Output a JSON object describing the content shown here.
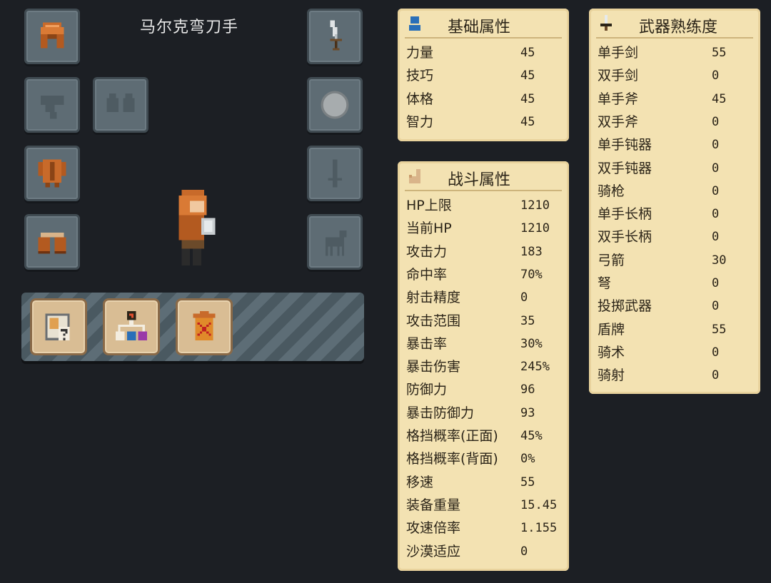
{
  "character": {
    "name": "马尔克弯刀手"
  },
  "basic_attributes": {
    "title": "基础属性",
    "icon": "person-icon",
    "rows": [
      {
        "label": "力量",
        "value": "45"
      },
      {
        "label": "技巧",
        "value": "45"
      },
      {
        "label": "体格",
        "value": "45"
      },
      {
        "label": "智力",
        "value": "45"
      }
    ]
  },
  "combat_attributes": {
    "title": "战斗属性",
    "icon": "arm-icon",
    "rows": [
      {
        "label": "HP上限",
        "value": "1210"
      },
      {
        "label": "当前HP",
        "value": "1210"
      },
      {
        "label": "攻击力",
        "value": "183"
      },
      {
        "label": "命中率",
        "value": "70%"
      },
      {
        "label": "射击精度",
        "value": "0"
      },
      {
        "label": "攻击范围",
        "value": "35"
      },
      {
        "label": "暴击率",
        "value": "30%"
      },
      {
        "label": "暴击伤害",
        "value": "245%"
      },
      {
        "label": "防御力",
        "value": "96"
      },
      {
        "label": "暴击防御力",
        "value": "93"
      },
      {
        "label": "格挡概率(正面)",
        "value": "45%"
      },
      {
        "label": "格挡概率(背面)",
        "value": "0%"
      },
      {
        "label": "移速",
        "value": "55"
      },
      {
        "label": "装备重量",
        "value": "15.45"
      },
      {
        "label": "攻速倍率",
        "value": "1.155"
      },
      {
        "label": "沙漠适应",
        "value": "0"
      }
    ]
  },
  "weapon_proficiency": {
    "title": "武器熟练度",
    "icon": "sword-icon",
    "rows": [
      {
        "label": "单手剑",
        "value": "55"
      },
      {
        "label": "双手剑",
        "value": "0"
      },
      {
        "label": "单手斧",
        "value": "45"
      },
      {
        "label": "双手斧",
        "value": "0"
      },
      {
        "label": "单手钝器",
        "value": "0"
      },
      {
        "label": "双手钝器",
        "value": "0"
      },
      {
        "label": "骑枪",
        "value": "0"
      },
      {
        "label": "单手长柄",
        "value": "0"
      },
      {
        "label": "双手长柄",
        "value": "0"
      },
      {
        "label": "弓箭",
        "value": "30"
      },
      {
        "label": "弩",
        "value": "0"
      },
      {
        "label": "投掷武器",
        "value": "0"
      },
      {
        "label": "盾牌",
        "value": "55"
      },
      {
        "label": "骑术",
        "value": "0"
      },
      {
        "label": "骑射",
        "value": "0"
      }
    ]
  },
  "equipment_slots": {
    "helmet": "helmet-icon",
    "cloak": "cloak-icon",
    "gloves": "gloves-icon",
    "armor": "body-armor-icon",
    "boots": "boots-icon",
    "main_weapon": "scimitar-icon",
    "shield": "round-shield-icon",
    "secondary_weapon": "sword-silhouette-icon",
    "mount": "horse-icon"
  },
  "toolbar": {
    "buttons": [
      "inspect-item-icon",
      "skill-tree-icon",
      "discard-trash-icon"
    ]
  },
  "colors": {
    "background": "#1c1f24",
    "panel": "#f3e2b2",
    "slot": "#5e6c74",
    "button": "#d9bd94",
    "accent_orange": "#c86a2a",
    "accent_blue": "#2a6fb8"
  }
}
